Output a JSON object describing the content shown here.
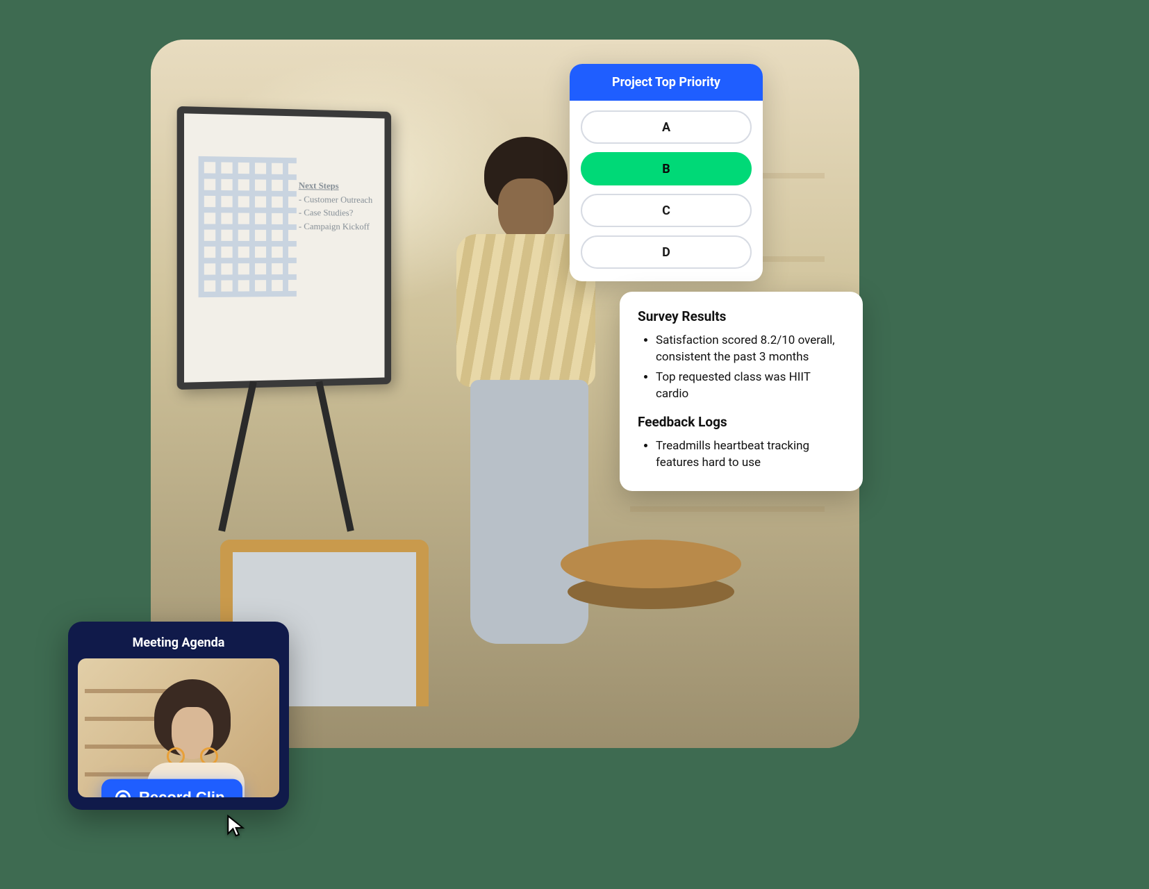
{
  "poll": {
    "title": "Project Top Priority",
    "options": [
      {
        "label": "A",
        "selected": false
      },
      {
        "label": "B",
        "selected": true
      },
      {
        "label": "C",
        "selected": false
      },
      {
        "label": "D",
        "selected": false
      }
    ]
  },
  "results": {
    "heading1": "Survey Results",
    "items1": [
      "Satisfaction scored 8.2/10 overall, consistent the past 3 months",
      "Top requested class was HIIT cardio"
    ],
    "heading2": "Feedback Logs",
    "items2": [
      "Treadmills heartbeat tracking features hard to use"
    ]
  },
  "agenda": {
    "title": "Meeting Agenda",
    "record_label": "Record Clip"
  },
  "whiteboard": {
    "heading": "Next Steps",
    "lines": [
      "- Customer Outreach",
      "- Case Studies?",
      "- Campaign Kickoff"
    ]
  },
  "colors": {
    "background": "#3e6b51",
    "primary_blue": "#1f5eff",
    "accent_green": "#00d977",
    "dark_navy": "#101a4a"
  }
}
